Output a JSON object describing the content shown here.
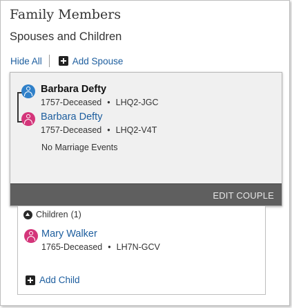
{
  "section": {
    "title": "Family Members",
    "subtitle": "Spouses and Children"
  },
  "actions": {
    "hide_all": "Hide All",
    "add_spouse": "Add Spouse"
  },
  "couple": {
    "husband": {
      "name": "Barbara Defty",
      "lifespan": "1757-Deceased",
      "separator": "•",
      "id": "LHQ2-JGC",
      "gender": "male"
    },
    "wife": {
      "name": "Barbara Defty",
      "lifespan": "1757-Deceased",
      "separator": "•",
      "id": "LHQ2-V4T",
      "gender": "female"
    },
    "events_text": "No Marriage Events",
    "edit_button": "EDIT COUPLE"
  },
  "children": {
    "header_label": "Children",
    "count": "(1)",
    "items": [
      {
        "name": "Mary Walker",
        "lifespan": "1765-Deceased",
        "separator": "•",
        "id": "LH7N-GCV",
        "gender": "female"
      }
    ],
    "add_child": "Add Child"
  },
  "colors": {
    "link": "#1c5d9e",
    "male": "#2f80c9",
    "female": "#d4357a",
    "edit_bar": "#5f5f5f"
  }
}
